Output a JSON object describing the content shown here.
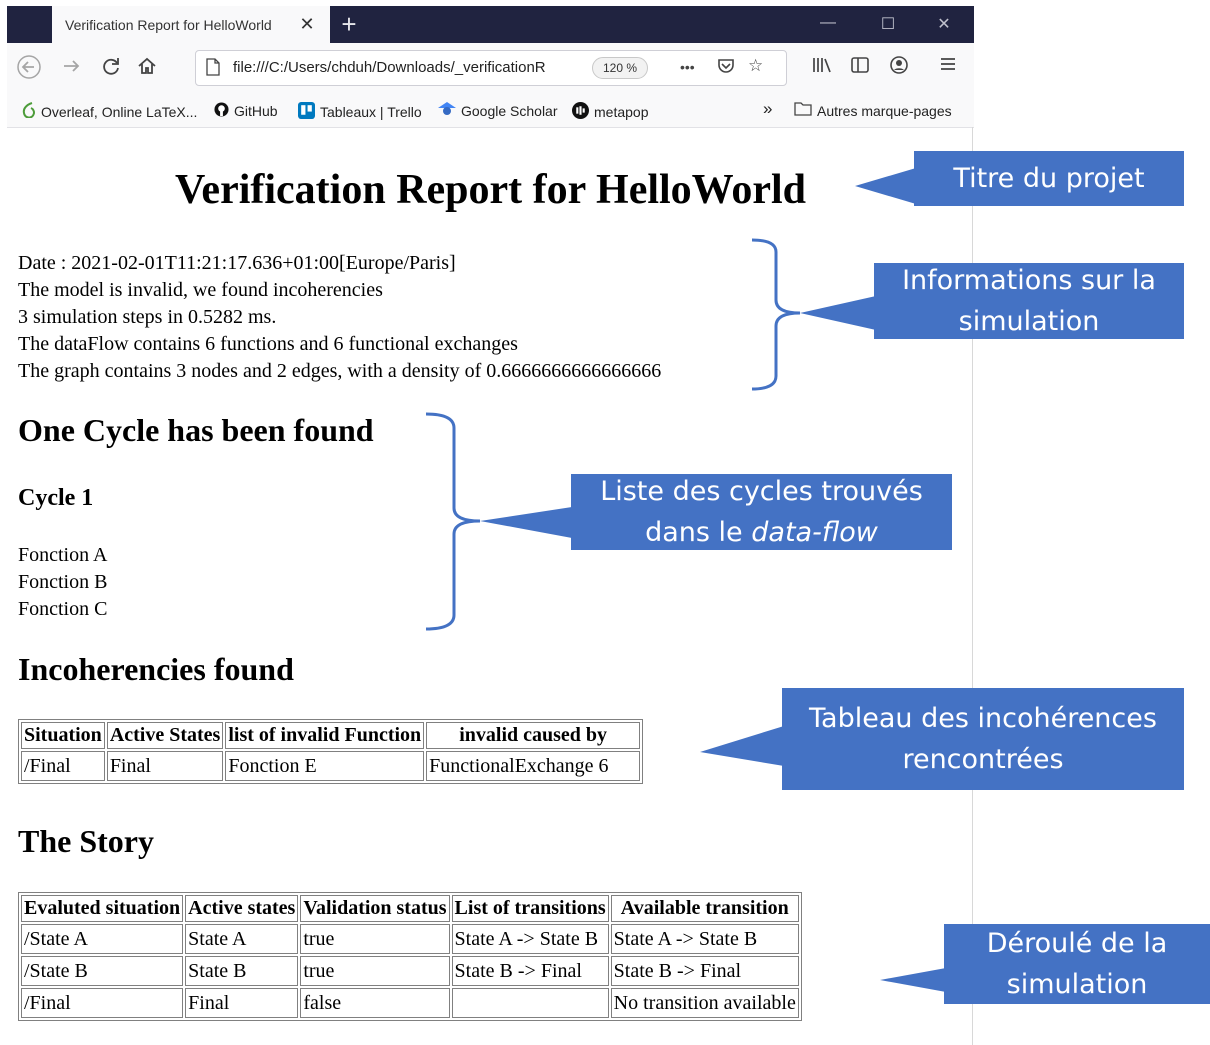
{
  "browser": {
    "tab_title": "Verification Report for HelloWorld",
    "tab_close": "✕",
    "new_tab": "+",
    "url": "file:///C:/Users/chduh/Downloads/_verificationR",
    "zoom": "120 %",
    "more_icon": "•••",
    "bookmarks": [
      {
        "label": "Overleaf, Online LaTeX...",
        "icon": "overleaf-icon",
        "color": "#4d9c3a"
      },
      {
        "label": "GitHub",
        "icon": "github-icon",
        "color": "#111111"
      },
      {
        "label": "Tableaux | Trello",
        "icon": "trello-icon",
        "color": "#0079bf"
      },
      {
        "label": "Google Scholar",
        "icon": "scholar-icon",
        "color": "#4285f4"
      },
      {
        "label": "metapop",
        "icon": "metapop-icon",
        "color": "#111111"
      }
    ],
    "overflow_chevron": "»",
    "other_bookmarks": "Autres marque-pages"
  },
  "report": {
    "title": "Verification Report for HelloWorld",
    "info_lines": [
      "Date : 2021-02-01T11:21:17.636+01:00[Europe/Paris]",
      "The model is invalid, we found incoherencies",
      "3 simulation steps in 0.5282 ms.",
      "The dataFlow contains 6 functions and 6 functional exchanges",
      "The graph contains 3 nodes and 2 edges, with a density of 0.6666666666666666"
    ],
    "cycle_heading": "One Cycle has been found",
    "cycle_subheading": "Cycle 1",
    "cycle_functions": [
      "Fonction A",
      "Fonction B",
      "Fonction C"
    ],
    "incoherencies_heading": "Incoherencies found",
    "incoherencies_table": {
      "headers": [
        "Situation",
        "Active States",
        "list of invalid Function",
        "invalid caused by"
      ],
      "rows": [
        [
          "/Final",
          "Final",
          "Fonction E",
          "FunctionalExchange 6"
        ]
      ]
    },
    "story_heading": "The Story",
    "story_table": {
      "headers": [
        "Evaluted situation",
        "Active states",
        "Validation status",
        "List of transitions",
        "Available transition"
      ],
      "rows": [
        [
          "/State A",
          "State A",
          "true",
          "State A -> State B",
          "State A -> State B"
        ],
        [
          "/State B",
          "State B",
          "true",
          "State B -> Final",
          "State B -> Final"
        ],
        [
          "/Final",
          "Final",
          "false",
          "",
          "No transition available"
        ]
      ]
    }
  },
  "annotations": {
    "title_callout": "Titre du projet",
    "info_callout_line1": "Informations sur la",
    "info_callout_line2": "simulation",
    "cycles_callout_line1": "Liste des cycles trouvés",
    "cycles_callout_line2_prefix": "dans le ",
    "cycles_callout_line2_italic": "data-flow",
    "incoherencies_callout_line1": "Tableau des incohérences",
    "incoherencies_callout_line2": "rencontrées",
    "story_callout_line1": "Déroulé de la",
    "story_callout_line2": "simulation",
    "callout_color": "#4472c4"
  }
}
